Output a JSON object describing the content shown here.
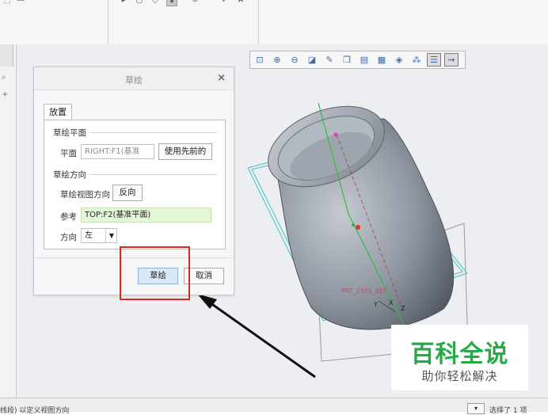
{
  "view_toolbar": {
    "icons": [
      "zoom-window-icon",
      "zoom-in-icon",
      "zoom-out-icon",
      "refit-icon",
      "repaint-icon",
      "named-views-icon",
      "saved-orientation-icon",
      "display-style-icon",
      "view-manager-icon",
      "datum-display-icon",
      "annotation-display-icon",
      "spin-center-icon"
    ]
  },
  "dialog": {
    "title": "草绘",
    "close": "×",
    "tab": "放置",
    "sketch_plane_section": "草绘平面",
    "plane_label": "平面",
    "plane_value": "RIGHT:F1(基准",
    "use_previous_button": "使用先前的",
    "sketch_orientation_section": "草绘方向",
    "view_direction_label": "草绘视图方向",
    "flip_button": "反向",
    "reference_label": "参考",
    "reference_value": "TOP:F2(基准平面)",
    "orientation_label": "方向",
    "orientation_value": "左",
    "sketch_button": "草绘",
    "cancel_button": "取消"
  },
  "model": {
    "csys_label": "PRT_CSYS_DEF",
    "x_label": "X",
    "y_label": "Y",
    "z_label": "Z"
  },
  "status_bar": {
    "message": "线段) 以定义视图方向",
    "selection": "选择了 1 项"
  },
  "watermark": {
    "title": "百科全说",
    "subtitle": "助你轻松解决"
  },
  "colors": {
    "accent_green": "#27a947",
    "highlight_red": "#e0261f",
    "reference_field_bg": "#e6f7d9",
    "model_gray": "#8e949c"
  }
}
